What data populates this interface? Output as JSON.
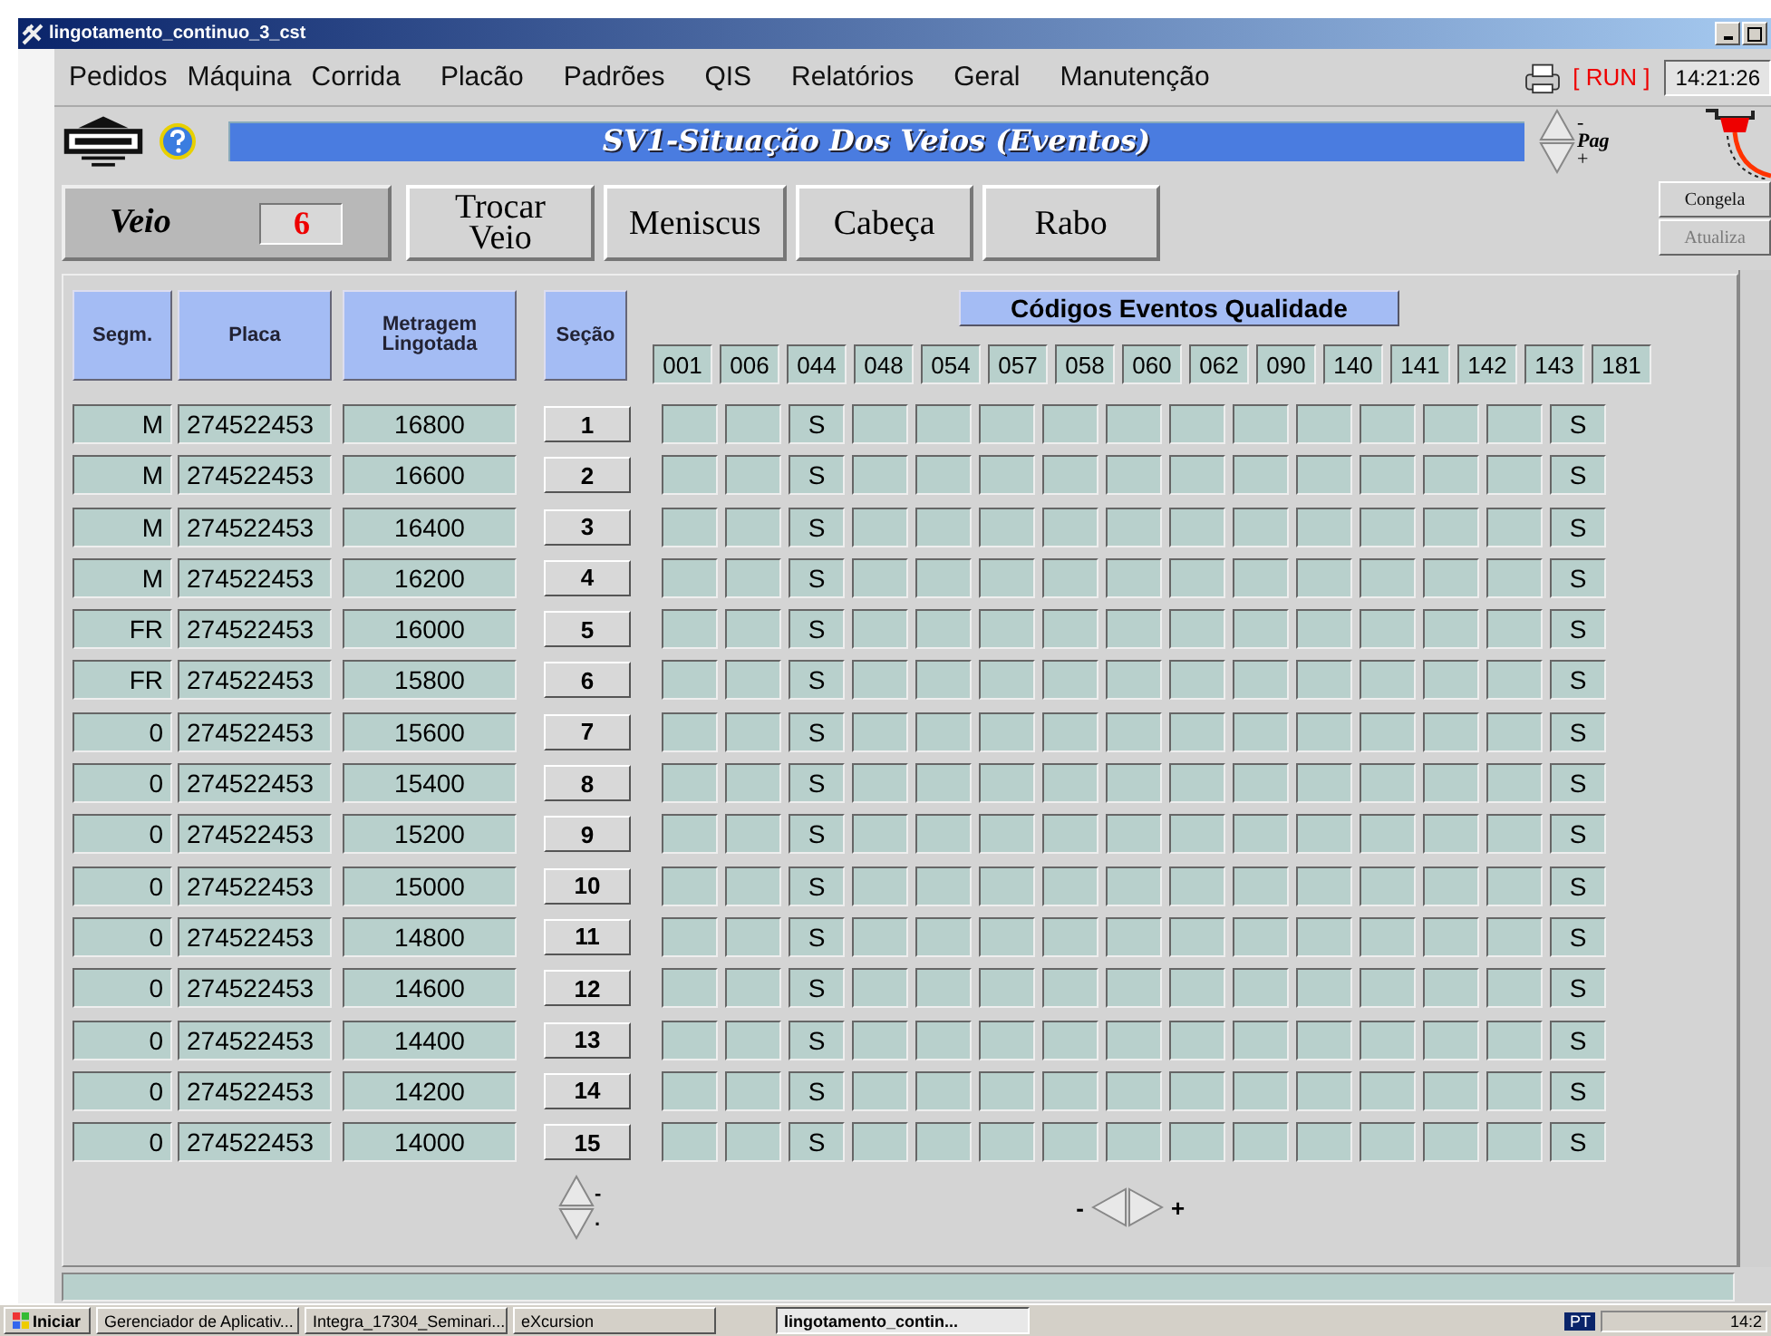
{
  "window": {
    "title": "lingotamento_continuo_3_cst"
  },
  "menu": [
    "Pedidos",
    "Máquina",
    "Corrida",
    "Placão",
    "Padrões",
    "QIS",
    "Relatórios",
    "Geral",
    "Manutenção"
  ],
  "status": {
    "run": "[ RUN ]",
    "time": "14:21:26"
  },
  "header": {
    "title": "SV1-Situação Dos Veios (Eventos)",
    "pag_minus": "-",
    "pag_label": "Pag",
    "pag_plus": "+"
  },
  "veio": {
    "label": "Veio",
    "value": "6"
  },
  "buttons": [
    {
      "label": "Trocar Veio"
    },
    {
      "label": "Meniscus"
    },
    {
      "label": "Cabeça"
    },
    {
      "label": "Rabo"
    }
  ],
  "side_buttons": [
    {
      "label": "Congela",
      "disabled": false
    },
    {
      "label": "Atualiza",
      "disabled": true
    }
  ],
  "table": {
    "columns": [
      "Segm.",
      "Placa",
      "Metragem Lingotada",
      "Seção"
    ],
    "events_title": "Códigos Eventos Qualidade",
    "event_columns": [
      {
        "code": "001"
      },
      {
        "code": "006"
      },
      {
        "code": "044",
        "cells": [
          "S",
          "S",
          "S",
          "S",
          "S",
          "S",
          "S",
          "S",
          "S",
          "S",
          "S",
          "S",
          "S",
          "S",
          "S"
        ]
      },
      {
        "code": "048"
      },
      {
        "code": "054"
      },
      {
        "code": "057"
      },
      {
        "code": "058"
      },
      {
        "code": "060"
      },
      {
        "code": "062"
      },
      {
        "code": "090"
      },
      {
        "code": "140"
      },
      {
        "code": "141"
      },
      {
        "code": "142"
      },
      {
        "code": "143"
      },
      {
        "code": "181",
        "cells": [
          "S",
          "S",
          "S",
          "S",
          "S",
          "S",
          "S",
          "S",
          "S",
          "S",
          "S",
          "S",
          "S",
          "S",
          "S"
        ]
      }
    ],
    "rows": [
      {
        "segm": "M",
        "placa": "274522453",
        "metragem": "16800",
        "secao": "1"
      },
      {
        "segm": "M",
        "placa": "274522453",
        "metragem": "16600",
        "secao": "2"
      },
      {
        "segm": "M",
        "placa": "274522453",
        "metragem": "16400",
        "secao": "3"
      },
      {
        "segm": "M",
        "placa": "274522453",
        "metragem": "16200",
        "secao": "4"
      },
      {
        "segm": "FR",
        "placa": "274522453",
        "metragem": "16000",
        "secao": "5"
      },
      {
        "segm": "FR",
        "placa": "274522453",
        "metragem": "15800",
        "secao": "6"
      },
      {
        "segm": "0",
        "placa": "274522453",
        "metragem": "15600",
        "secao": "7"
      },
      {
        "segm": "0",
        "placa": "274522453",
        "metragem": "15400",
        "secao": "8"
      },
      {
        "segm": "0",
        "placa": "274522453",
        "metragem": "15200",
        "secao": "9"
      },
      {
        "segm": "0",
        "placa": "274522453",
        "metragem": "15000",
        "secao": "10"
      },
      {
        "segm": "0",
        "placa": "274522453",
        "metragem": "14800",
        "secao": "11"
      },
      {
        "segm": "0",
        "placa": "274522453",
        "metragem": "14600",
        "secao": "12"
      },
      {
        "segm": "0",
        "placa": "274522453",
        "metragem": "14400",
        "secao": "13"
      },
      {
        "segm": "0",
        "placa": "274522453",
        "metragem": "14200",
        "secao": "14"
      },
      {
        "segm": "0",
        "placa": "274522453",
        "metragem": "14000",
        "secao": "15"
      }
    ]
  },
  "row_spinner": {
    "minus": "-",
    "plus": "."
  },
  "col_spinner": {
    "minus": "-",
    "plus": "+"
  },
  "taskbar": {
    "start": "Iniciar",
    "items": [
      {
        "label": "Gerenciador de Aplicativ...",
        "selected": false
      },
      {
        "label": "Integra_17304_Seminari...",
        "selected": false
      },
      {
        "label": "eXcursion",
        "selected": false
      },
      {
        "label": "lingotamento_contin...",
        "selected": true
      }
    ],
    "lang": "PT",
    "clock": "14:2"
  }
}
